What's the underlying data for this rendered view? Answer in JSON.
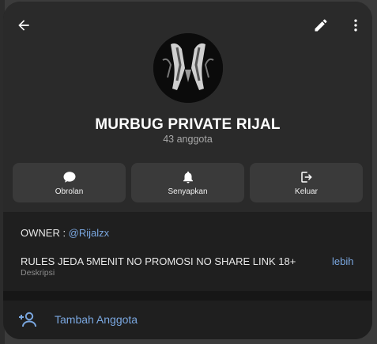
{
  "colors": {
    "accent": "#7aa7e0",
    "card_bg": "#1f1f1f",
    "header_bg": "#2a2a2a",
    "button_bg": "#3a3a3a"
  },
  "header": {
    "back_icon": "arrow-left-icon",
    "edit_icon": "pencil-icon",
    "more_icon": "more-vertical-icon",
    "group_name": "MURBUG PRIVATE RIJAL",
    "member_count": "43 anggota"
  },
  "actions": [
    {
      "label": "Obrolan",
      "icon": "chat-bubble-icon"
    },
    {
      "label": "Senyapkan",
      "icon": "bell-icon"
    },
    {
      "label": "Keluar",
      "icon": "logout-icon"
    }
  ],
  "info": {
    "owner_prefix": "OWNER : ",
    "owner_handle": "@Rijalzx",
    "rules_text": "RULES JEDA 5MENIT NO PROMOSI NO SHARE LINK 18+",
    "more_label": "lebih",
    "description_caption": "Deskripsi"
  },
  "add_member": {
    "label": "Tambah Anggota",
    "icon": "add-person-icon"
  }
}
